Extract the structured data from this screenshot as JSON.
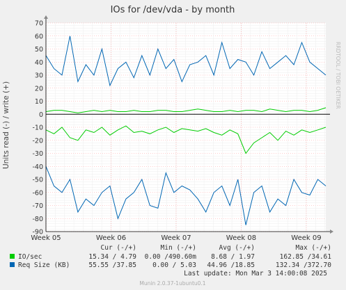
{
  "chart_data": {
    "type": "line",
    "title": "IOs for /dev/vda - by month",
    "ylabel": "Units read (-) / write (+)",
    "side_text": "RRDTOOL / TOBI OETIKER",
    "ylim": [
      -90,
      70
    ],
    "yticks": [
      70,
      60,
      50,
      40,
      30,
      20,
      10,
      0,
      -10,
      -20,
      -30,
      -40,
      -50,
      -60,
      -70,
      -80,
      -90
    ],
    "xticks": [
      "Week 05",
      "Week 06",
      "Week 07",
      "Week 08",
      "Week 09"
    ],
    "grid": true,
    "series": [
      {
        "name": "IO/sec",
        "color": "#00cc00",
        "write": [
          2,
          3,
          3,
          2,
          1,
          2,
          3,
          2,
          3,
          2,
          2,
          3,
          2,
          2,
          3,
          3,
          2,
          2,
          3,
          4,
          3,
          2,
          2,
          3,
          2,
          3,
          3,
          2,
          4,
          3,
          2,
          3,
          3,
          2,
          3,
          5
        ],
        "read": [
          -12,
          -15,
          -10,
          -18,
          -20,
          -12,
          -14,
          -10,
          -16,
          -12,
          -9,
          -14,
          -13,
          -15,
          -12,
          -10,
          -14,
          -11,
          -12,
          -13,
          -11,
          -14,
          -16,
          -12,
          -15,
          -30,
          -22,
          -18,
          -14,
          -20,
          -13,
          -16,
          -12,
          -14,
          -12,
          -10
        ]
      },
      {
        "name": "Req Size (KB)",
        "color": "#0066b3",
        "write": [
          45,
          35,
          30,
          60,
          25,
          38,
          30,
          50,
          22,
          35,
          40,
          28,
          45,
          30,
          50,
          35,
          42,
          25,
          38,
          40,
          45,
          30,
          55,
          35,
          42,
          40,
          30,
          48,
          35,
          40,
          45,
          38,
          55,
          40,
          35,
          30
        ],
        "read": [
          -40,
          -55,
          -60,
          -50,
          -75,
          -65,
          -70,
          -60,
          -55,
          -80,
          -65,
          -60,
          -50,
          -70,
          -72,
          -45,
          -60,
          -55,
          -58,
          -65,
          -75,
          -60,
          -55,
          -70,
          -50,
          -85,
          -60,
          -55,
          -75,
          -65,
          -70,
          -50,
          -60,
          -62,
          -50,
          -55
        ]
      }
    ]
  },
  "legend": {
    "headers": {
      "cur": "Cur (-/+)",
      "min": "Min (-/+)",
      "avg": "Avg (-/+)",
      "max": "Max (-/+)"
    },
    "rows": [
      {
        "label": "IO/sec",
        "color": "#00cc00",
        "cur": "15.34 /  4.79",
        "min": "0.00 /490.60m",
        "avg": "8.68 /  1.97",
        "max": "162.85 /34.61"
      },
      {
        "label": "Req Size (KB)",
        "color": "#0066b3",
        "cur": "55.55 /37.85",
        "min": "0.00 /  5.03",
        "avg": "44.96 /18.85",
        "max": "132.34 /372.70"
      }
    ],
    "last_update": "Last update: Mon Mar  3 14:00:08 2025"
  },
  "footer": "Munin 2.0.37-1ubuntu0.1"
}
